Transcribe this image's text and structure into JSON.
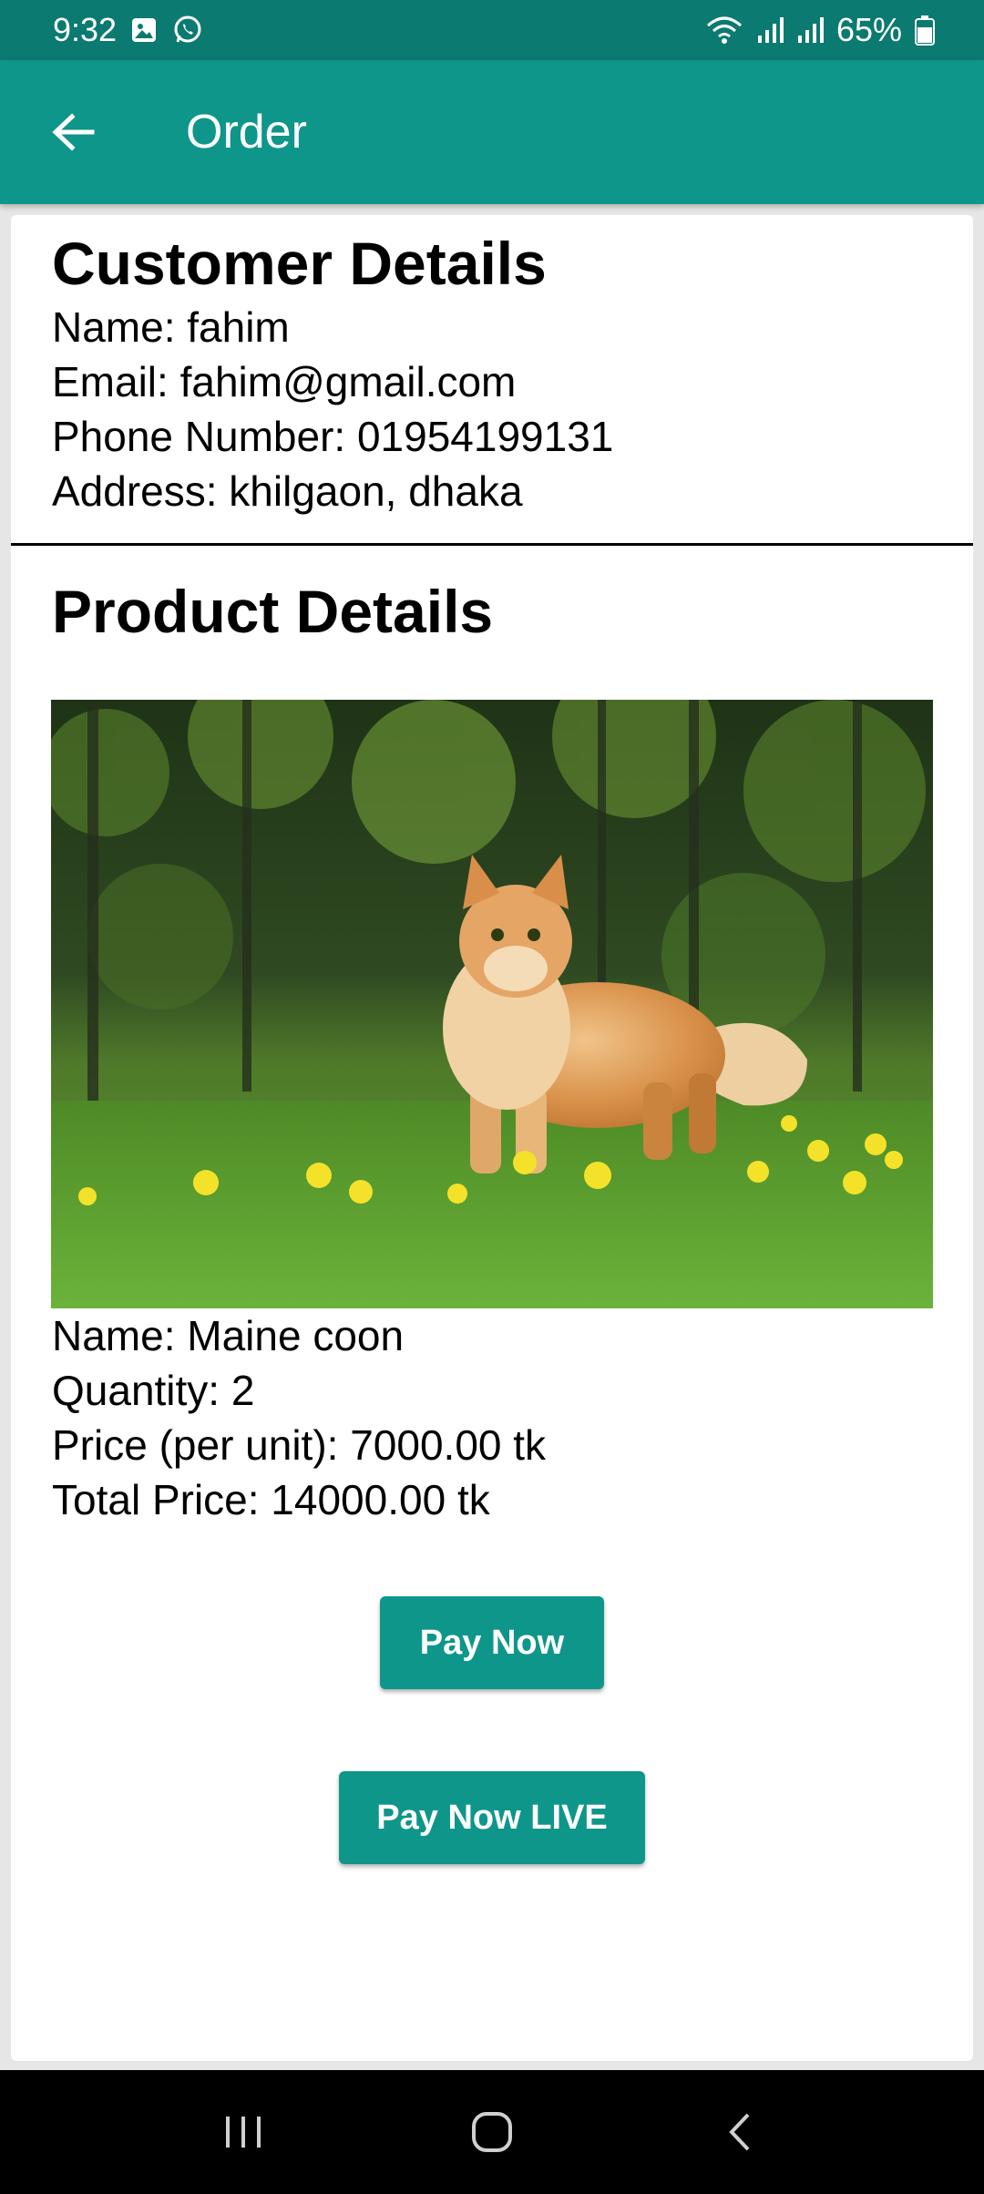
{
  "status_bar": {
    "time": "9:32",
    "battery": "65%",
    "icons": [
      "gallery-icon",
      "whatsapp-icon",
      "wifi-icon",
      "signal-icon",
      "signal-icon",
      "battery-icon"
    ]
  },
  "app_bar": {
    "title": "Order",
    "back_icon": "arrow-left-icon",
    "background": "#0f968a"
  },
  "customer": {
    "title": "Customer Details",
    "name": "Name: fahim",
    "email": "Email: fahim@gmail.com",
    "phone": "Phone Number: 01954199131",
    "address": "Address: khilgaon, dhaka"
  },
  "product": {
    "title": "Product Details",
    "image_subject": "orange maine coon cat in grass",
    "name": "Name: Maine coon",
    "quantity": "Quantity: 2",
    "price": "Price (per unit): 7000.00 tk",
    "total": "Total Price: 14000.00 tk"
  },
  "actions": {
    "pay_now": "Pay Now",
    "pay_now_live": "Pay Now LIVE",
    "button_color": "#0f968a"
  },
  "nav_bar": {
    "icons": [
      "recents-icon",
      "home-icon",
      "back-icon"
    ]
  }
}
